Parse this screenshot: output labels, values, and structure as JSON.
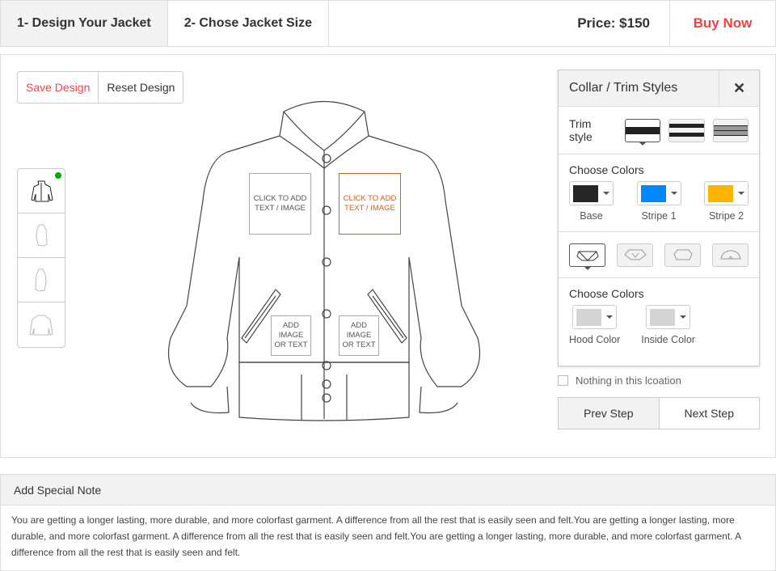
{
  "tabs": [
    {
      "label": "1- Design Your Jacket",
      "active": true
    },
    {
      "label": "2- Chose Jacket Size",
      "active": false
    }
  ],
  "price": "Price: $150",
  "buy_now": "Buy Now",
  "toolbar": {
    "save": "Save Design",
    "reset": "Reset Design"
  },
  "views": [
    "front-view-icon",
    "left-side-view-icon",
    "right-side-view-icon",
    "back-view-icon"
  ],
  "zones": {
    "chest_left": "CLICK TO ADD TEXT / IMAGE",
    "chest_right": "CLICK TO ADD TEXT / IMAGE",
    "pocket_left": "ADD IMAGE OR TEXT",
    "pocket_right": "ADD IMAGE OR TEXT"
  },
  "panel": {
    "title": "Collar / Trim Styles",
    "trim_label": "Trim style",
    "choose_colors": "Choose Colors",
    "colors": [
      {
        "label": "Base",
        "color": "#262626"
      },
      {
        "label": "Stripe 1",
        "color": "#0088ff"
      },
      {
        "label": "Stripe 2",
        "color": "#ffb400"
      }
    ],
    "collar_colors": [
      {
        "label": "Hood Color",
        "color": "#d4d4d4"
      },
      {
        "label": "Inside Color",
        "color": "#d4d4d4"
      }
    ]
  },
  "nothing_label": "Nothing in this lcoation",
  "steps": {
    "prev": "Prev Step",
    "next": "Next Step"
  },
  "note": {
    "title": "Add Special Note",
    "text": "You are getting a longer lasting, more durable, and more colorfast garment. A difference from all the rest that is easily seen and felt.You are getting a longer lasting, more durable, and more colorfast garment. A difference from all the rest that is easily seen and felt.You are getting a longer lasting, more durable, and more colorfast garment. A difference from all the rest that is easily seen and felt."
  }
}
